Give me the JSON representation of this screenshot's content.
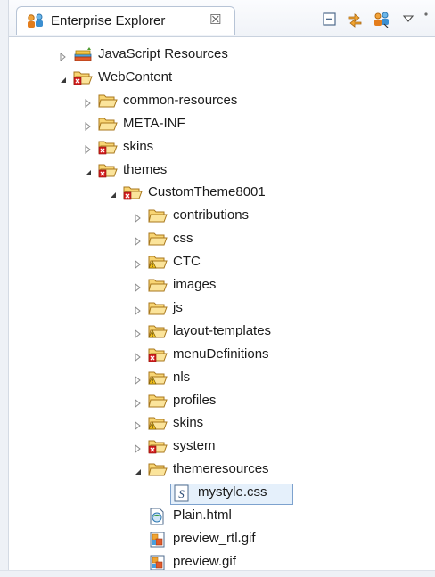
{
  "view": {
    "title": "Enterprise Explorer",
    "close_glyph": "☒",
    "toolbar": [
      {
        "name": "collapse-all-icon"
      },
      {
        "name": "link-with-editor-icon"
      },
      {
        "name": "people-icon"
      },
      {
        "name": "view-menu-icon"
      }
    ]
  },
  "tree": [
    {
      "label": "JavaScript Resources",
      "level": 0,
      "toggle": "collapsed",
      "icon": "library-icon"
    },
    {
      "label": "WebContent",
      "level": 0,
      "toggle": "expanded",
      "icon": "folder-open-error-icon"
    },
    {
      "label": "common-resources",
      "level": 1,
      "toggle": "collapsed",
      "icon": "folder-icon"
    },
    {
      "label": "META-INF",
      "level": 1,
      "toggle": "collapsed",
      "icon": "folder-icon"
    },
    {
      "label": "skins",
      "level": 1,
      "toggle": "collapsed",
      "icon": "folder-error-icon"
    },
    {
      "label": "themes",
      "level": 1,
      "toggle": "expanded",
      "icon": "folder-error-icon"
    },
    {
      "label": "CustomTheme8001",
      "level": 2,
      "toggle": "expanded",
      "icon": "folder-error-icon"
    },
    {
      "label": "contributions",
      "level": 3,
      "toggle": "collapsed",
      "icon": "folder-icon"
    },
    {
      "label": "css",
      "level": 3,
      "toggle": "collapsed",
      "icon": "folder-icon"
    },
    {
      "label": "CTC",
      "level": 3,
      "toggle": "collapsed",
      "icon": "folder-warning-icon"
    },
    {
      "label": "images",
      "level": 3,
      "toggle": "collapsed",
      "icon": "folder-icon"
    },
    {
      "label": "js",
      "level": 3,
      "toggle": "collapsed",
      "icon": "folder-icon"
    },
    {
      "label": "layout-templates",
      "level": 3,
      "toggle": "collapsed",
      "icon": "folder-warning-icon"
    },
    {
      "label": "menuDefinitions",
      "level": 3,
      "toggle": "collapsed",
      "icon": "folder-error-icon"
    },
    {
      "label": "nls",
      "level": 3,
      "toggle": "collapsed",
      "icon": "folder-warning-icon"
    },
    {
      "label": "profiles",
      "level": 3,
      "toggle": "collapsed",
      "icon": "folder-icon"
    },
    {
      "label": "skins",
      "level": 3,
      "toggle": "collapsed",
      "icon": "folder-warning-icon"
    },
    {
      "label": "system",
      "level": 3,
      "toggle": "collapsed",
      "icon": "folder-error-icon"
    },
    {
      "label": "themeresources",
      "level": 3,
      "toggle": "expanded",
      "icon": "folder-icon"
    },
    {
      "label": "mystyle.css",
      "level": 4,
      "toggle": "none",
      "icon": "css-file-icon",
      "selected": true
    },
    {
      "label": "Plain.html",
      "level": 3,
      "toggle": "none",
      "icon": "html-file-icon"
    },
    {
      "label": "preview_rtl.gif",
      "level": 3,
      "toggle": "none",
      "icon": "image-file-icon"
    },
    {
      "label": "preview.gif",
      "level": 3,
      "toggle": "none",
      "icon": "image-file-icon"
    }
  ]
}
